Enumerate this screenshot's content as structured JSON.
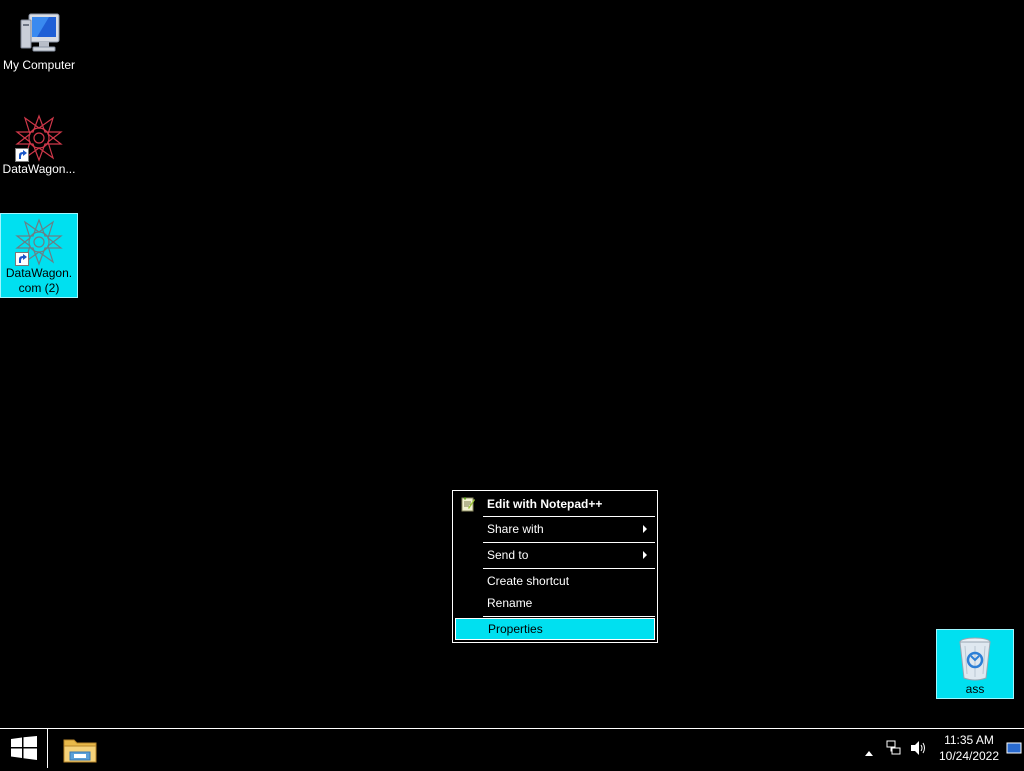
{
  "desktop": {
    "icons": [
      {
        "label": "My Computer",
        "icon": "computer-icon"
      },
      {
        "label": "DataWagon...",
        "icon": "datawagon-star-icon"
      },
      {
        "label": "DataWagon.com (2)",
        "icon": "datawagon-star-icon"
      },
      {
        "label": "ass",
        "icon": "recycle-bin-icon"
      }
    ],
    "selection_color": "#00e0f0"
  },
  "context_menu": {
    "items": [
      {
        "label": "Edit with Notepad++",
        "icon": "notepadpp-icon",
        "bold": true
      },
      {
        "label": "Share with",
        "submenu": true
      },
      {
        "label": "Send to",
        "submenu": true
      },
      {
        "label": "Create shortcut"
      },
      {
        "label": "Rename"
      },
      {
        "label": "Properties",
        "highlighted": true
      }
    ]
  },
  "taskbar": {
    "start_icon": "windows-logo-icon",
    "pinned": [
      {
        "name": "File Explorer",
        "icon": "folder-icon"
      }
    ],
    "tray": {
      "icons": [
        "show-hidden-icons-chevron",
        "network-icon",
        "volume-icon",
        "show-desktop-icon"
      ],
      "time": "11:35 AM",
      "date": "10/24/2022"
    }
  }
}
